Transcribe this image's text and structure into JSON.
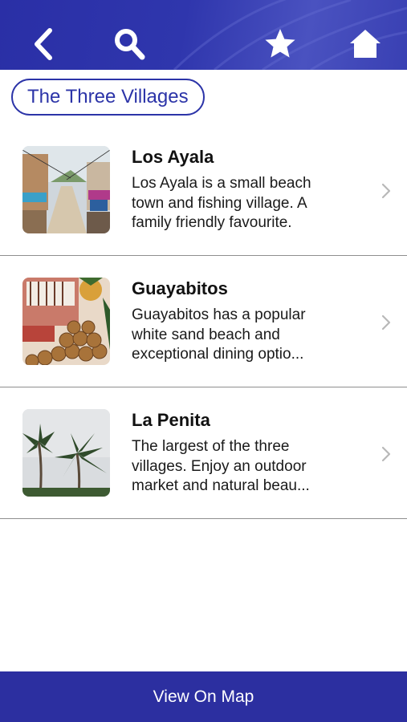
{
  "header": {
    "icons": [
      "back-icon",
      "search-icon",
      "star-icon",
      "home-icon"
    ],
    "colors": {
      "bar": "#2f36ad",
      "icon": "#ffffff"
    }
  },
  "page": {
    "title": "The Three Villages"
  },
  "villages": [
    {
      "name": "Los Ayala",
      "description": "Los Ayala is a small beach town and fishing village. A family friendly favourite."
    },
    {
      "name": "Guayabitos",
      "description": "Guayabitos has a popular white sand beach and exceptional dining optio..."
    },
    {
      "name": "La Penita",
      "description": "The largest of the three villages. Enjoy an outdoor market and natural beau..."
    }
  ],
  "footer": {
    "label": "View On Map",
    "color": "#2c2fa0"
  }
}
